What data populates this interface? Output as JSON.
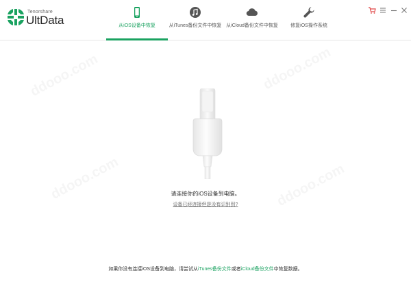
{
  "app": {
    "brand_small": "Tenorshare",
    "brand_name": "UltData"
  },
  "colors": {
    "accent": "#1aa260",
    "logo": "#1aa260",
    "cart": "#e04848"
  },
  "tabs": [
    {
      "label": "从iOS设备中恢复",
      "icon": "phone-icon",
      "active": true
    },
    {
      "label": "从iTunes备份文件中恢复",
      "icon": "music-note-icon",
      "active": false
    },
    {
      "label": "从iCloud备份文件中恢复",
      "icon": "cloud-icon",
      "active": false
    },
    {
      "label": "修复iOS操作系统",
      "icon": "wrench-icon",
      "active": false
    }
  ],
  "window_controls": [
    {
      "icon": "cart-icon"
    },
    {
      "icon": "menu-icon"
    },
    {
      "icon": "minimize-icon"
    },
    {
      "icon": "close-icon"
    }
  ],
  "main": {
    "connect_message": "请连接你的iOS设备到电脑。",
    "help_link": "设备已经连接但是没有识别到?"
  },
  "footer": {
    "prefix": "如果你没有连接iOS设备到电脑，请尝试从",
    "itunes_link": "iTunes备份文件",
    "middle": "或者",
    "icloud_link": "iCloud备份文件",
    "suffix": "中恢复数据。"
  }
}
